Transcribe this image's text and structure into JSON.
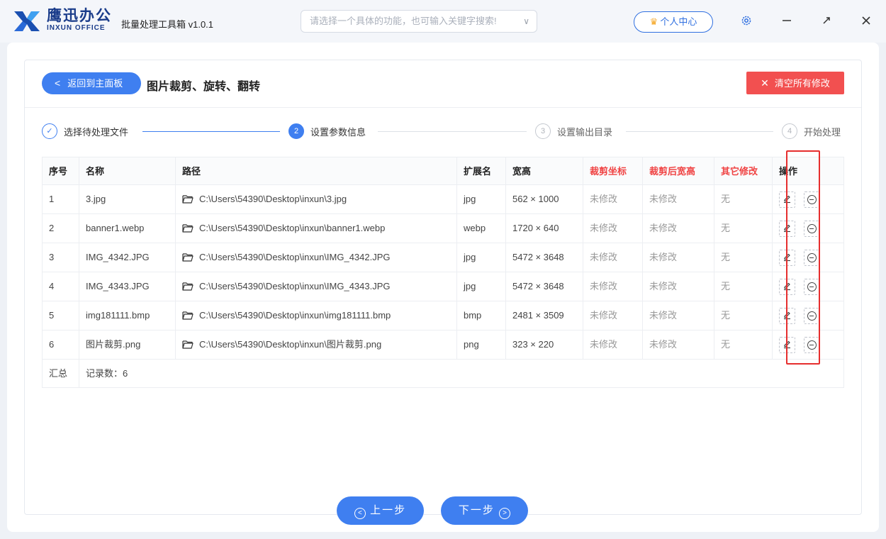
{
  "app": {
    "brand_cn": "鹰迅办公",
    "brand_en": "INXUN OFFICE",
    "title": "批量处理工具箱 v1.0.1",
    "search_placeholder": "请选择一个具体的功能，也可输入关键字搜索!",
    "user_center": "个人中心",
    "accent": "#3f7ff0",
    "danger": "#f25050"
  },
  "toolbar": {
    "back_label": "返回到主面板",
    "page_title": "图片裁剪、旋转、翻转",
    "clear_label": "清空所有修改"
  },
  "steps": [
    {
      "num": "✓",
      "label": "选择待处理文件",
      "state": "done"
    },
    {
      "num": "2",
      "label": "设置参数信息",
      "state": "active"
    },
    {
      "num": "3",
      "label": "设置输出目录",
      "state": "todo"
    },
    {
      "num": "4",
      "label": "开始处理",
      "state": "todo"
    }
  ],
  "table": {
    "headers": {
      "index": "序号",
      "name": "名称",
      "path": "路径",
      "ext": "扩展名",
      "size": "宽高",
      "crop_coord": "裁剪坐标",
      "crop_size": "裁剪后宽高",
      "other": "其它修改",
      "action": "操作"
    },
    "rows": [
      {
        "index": "1",
        "name": "3.jpg",
        "path": "C:\\Users\\54390\\Desktop\\inxun\\3.jpg",
        "ext": "jpg",
        "size": "562 × 1000",
        "crop_coord": "未修改",
        "crop_size": "未修改",
        "other": "无"
      },
      {
        "index": "2",
        "name": "banner1.webp",
        "path": "C:\\Users\\54390\\Desktop\\inxun\\banner1.webp",
        "ext": "webp",
        "size": "1720 × 640",
        "crop_coord": "未修改",
        "crop_size": "未修改",
        "other": "无"
      },
      {
        "index": "3",
        "name": "IMG_4342.JPG",
        "path": "C:\\Users\\54390\\Desktop\\inxun\\IMG_4342.JPG",
        "ext": "jpg",
        "size": "5472 × 3648",
        "crop_coord": "未修改",
        "crop_size": "未修改",
        "other": "无"
      },
      {
        "index": "4",
        "name": "IMG_4343.JPG",
        "path": "C:\\Users\\54390\\Desktop\\inxun\\IMG_4343.JPG",
        "ext": "jpg",
        "size": "5472 × 3648",
        "crop_coord": "未修改",
        "crop_size": "未修改",
        "other": "无"
      },
      {
        "index": "5",
        "name": "img181111.bmp",
        "path": "C:\\Users\\54390\\Desktop\\inxun\\img181111.bmp",
        "ext": "bmp",
        "size": "2481 × 3509",
        "crop_coord": "未修改",
        "crop_size": "未修改",
        "other": "无"
      },
      {
        "index": "6",
        "name": "图片裁剪.png",
        "path": "C:\\Users\\54390\\Desktop\\inxun\\图片裁剪.png",
        "ext": "png",
        "size": "323 × 220",
        "crop_coord": "未修改",
        "crop_size": "未修改",
        "other": "无"
      }
    ],
    "summary_label": "汇总",
    "summary_value": "记录数：6"
  },
  "footer": {
    "prev_label": "上一步",
    "next_label": "下一步"
  }
}
